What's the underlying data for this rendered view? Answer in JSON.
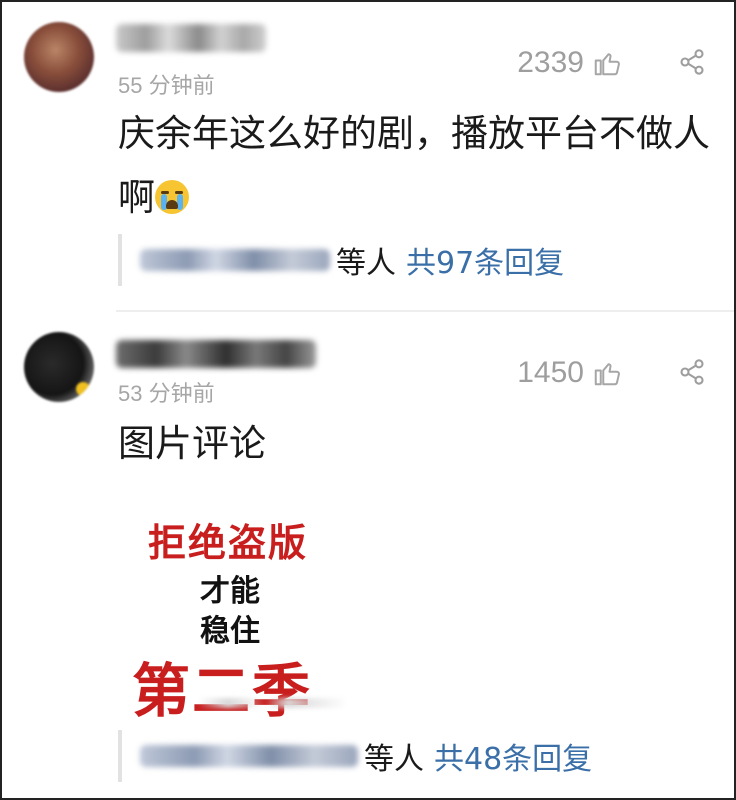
{
  "comments": [
    {
      "time": "55 分钟前",
      "likes": "2339",
      "text": "庆余年这么好的剧，播放平台不做人啊",
      "emoji": "loudly-crying-face",
      "reply_suffix": "等人",
      "reply_count_label": "共97条回复"
    },
    {
      "time": "53 分钟前",
      "likes": "1450",
      "text": "图片评论",
      "image": {
        "line1": "拒绝盗版",
        "line2": "才能",
        "line3": "稳住",
        "line4": "第二季"
      },
      "reply_suffix": "等人",
      "reply_count_label": "共48条回复"
    }
  ],
  "icons": {
    "like": "thumbs-up-icon",
    "share": "share-icon"
  },
  "colors": {
    "link_blue": "#3a6fa8",
    "muted_gray": "#a6a6a6",
    "image_red": "#c81e1e"
  }
}
